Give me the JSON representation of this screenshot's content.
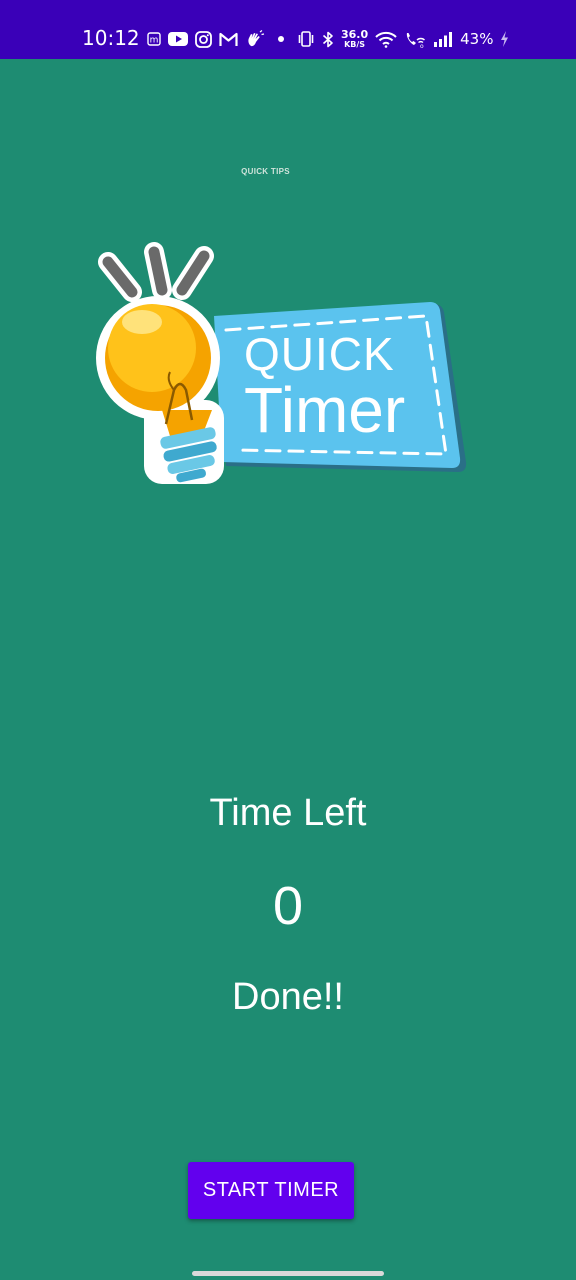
{
  "status_bar": {
    "time": "10:12",
    "net_speed_value": "36.0",
    "net_speed_unit": "KB/S",
    "battery_percent": "43%",
    "background": "#3a00b8",
    "icons": [
      "m-app-icon",
      "youtube-icon",
      "instagram-icon",
      "gmail-icon",
      "hand-wave-icon",
      "dot-icon",
      "vibrate-icon",
      "bluetooth-icon",
      "wifi-icon",
      "wifi-call-icon",
      "signal-icon",
      "battery-charging-icon"
    ]
  },
  "app": {
    "caption": "QUICK TIPS",
    "background": "#1e8c72",
    "logo": {
      "line1": "QUICK",
      "line2": "Timer",
      "icon": "light-bulb-icon"
    }
  },
  "timer": {
    "label": "Time Left",
    "value": "0",
    "message": "Done!!"
  },
  "button": {
    "start_label": "START TIMER",
    "color": "#6200ee"
  }
}
